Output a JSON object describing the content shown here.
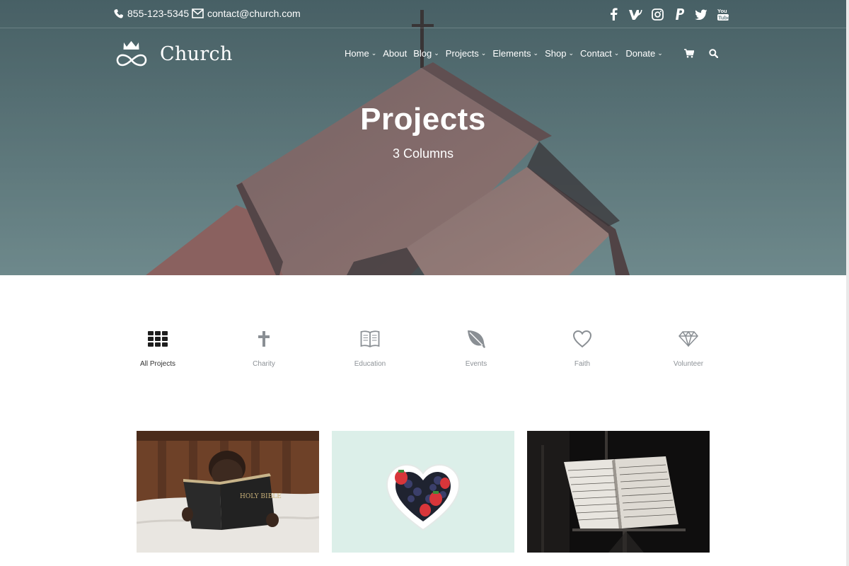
{
  "topbar": {
    "phone": "855-123-5345",
    "email": "contact@church.com",
    "social": [
      "facebook-icon",
      "vine-icon",
      "instagram-icon",
      "paypal-icon",
      "twitter-icon",
      "youtube-icon"
    ]
  },
  "brand": {
    "name": "Church"
  },
  "nav": {
    "items": [
      {
        "label": "Home",
        "has_dropdown": true
      },
      {
        "label": "About",
        "has_dropdown": false
      },
      {
        "label": "Blog",
        "has_dropdown": true
      },
      {
        "label": "Projects",
        "has_dropdown": true
      },
      {
        "label": "Elements",
        "has_dropdown": true
      },
      {
        "label": "Shop",
        "has_dropdown": true
      },
      {
        "label": "Contact",
        "has_dropdown": true
      },
      {
        "label": "Donate",
        "has_dropdown": true
      }
    ],
    "icons": [
      "cart-icon",
      "search-icon"
    ]
  },
  "hero": {
    "title": "Projects",
    "subtitle": "3 Columns"
  },
  "filters": [
    {
      "label": "All Projects",
      "icon": "grid-icon",
      "active": true
    },
    {
      "label": "Charity",
      "icon": "cross-icon",
      "active": false
    },
    {
      "label": "Education",
      "icon": "open-book-icon",
      "active": false
    },
    {
      "label": "Events",
      "icon": "leaf-icon",
      "active": false
    },
    {
      "label": "Faith",
      "icon": "heart-icon",
      "active": false
    },
    {
      "label": "Volunteer",
      "icon": "diamond-icon",
      "active": false
    }
  ],
  "projects": [
    {
      "image": "child-reading-bible-photo",
      "book_text": "HOLY BIBLE"
    },
    {
      "image": "heart-bowl-berries-photo"
    },
    {
      "image": "sheet-music-stand-photo"
    }
  ],
  "colors": {
    "accent": "#ffffff",
    "hero_tint": "#5e7a80",
    "filter_active": "#1e1e1e",
    "filter_inactive": "#8a8f94"
  }
}
